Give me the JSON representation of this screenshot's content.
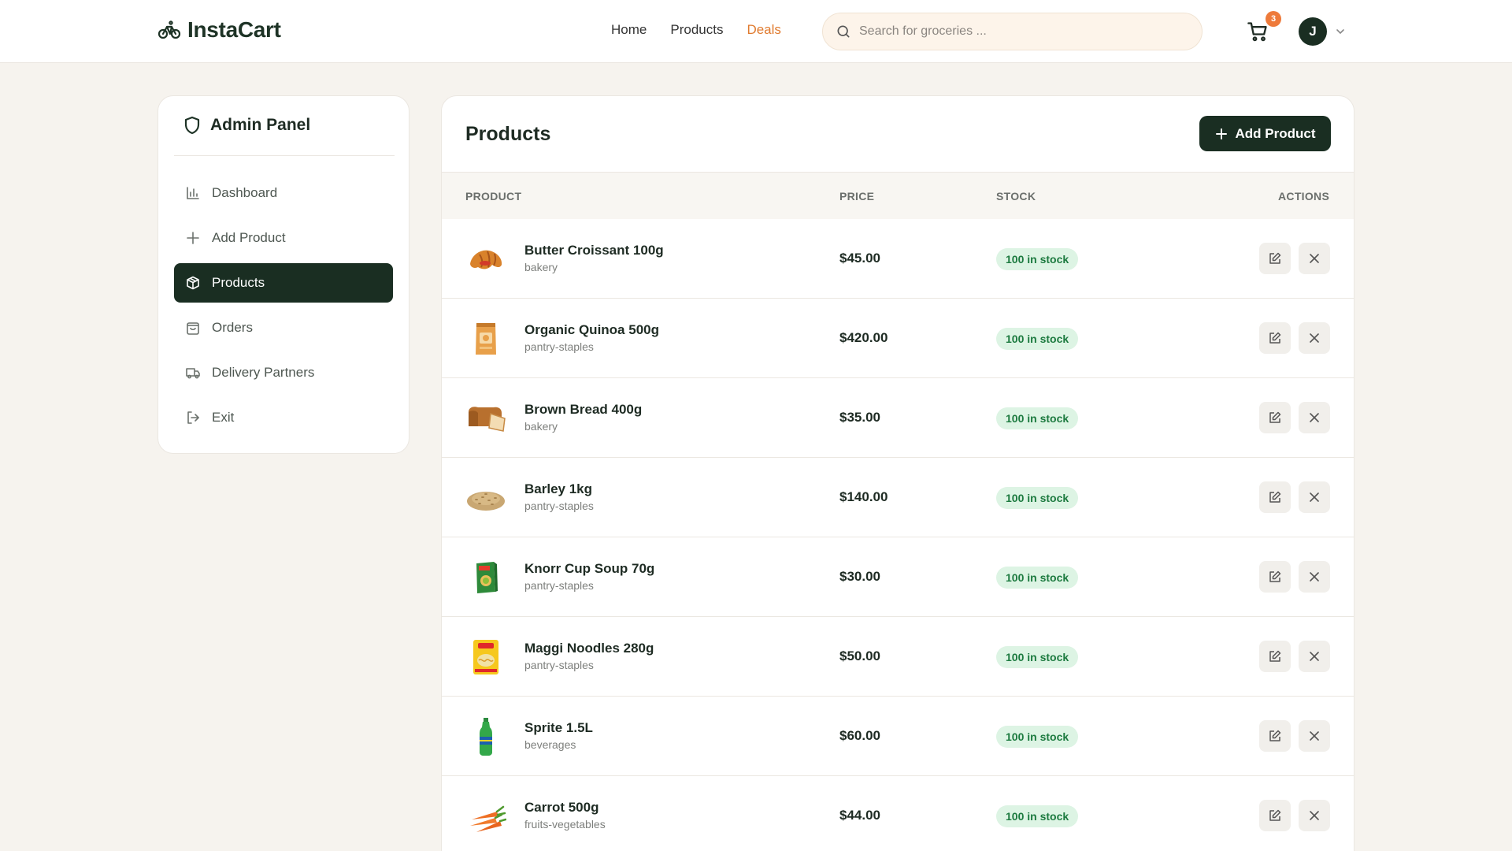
{
  "header": {
    "brand": "InstaCart",
    "nav": [
      {
        "label": "Home",
        "active": false
      },
      {
        "label": "Products",
        "active": false
      },
      {
        "label": "Deals",
        "active": true
      }
    ],
    "search_placeholder": "Search for groceries ...",
    "cart_count": "3",
    "avatar_initial": "J"
  },
  "sidebar": {
    "title": "Admin Panel",
    "items": [
      {
        "label": "Dashboard",
        "icon": "bar-chart-icon",
        "active": false
      },
      {
        "label": "Add Product",
        "icon": "plus-icon",
        "active": false
      },
      {
        "label": "Products",
        "icon": "package-icon",
        "active": true
      },
      {
        "label": "Orders",
        "icon": "shopping-bag-icon",
        "active": false
      },
      {
        "label": "Delivery Partners",
        "icon": "truck-icon",
        "active": false
      },
      {
        "label": "Exit",
        "icon": "logout-icon",
        "active": false
      }
    ]
  },
  "main": {
    "title": "Products",
    "add_button_label": "Add Product",
    "columns": [
      "PRODUCT",
      "PRICE",
      "STOCK",
      "ACTIONS"
    ],
    "rows": [
      {
        "name": "Butter Croissant 100g",
        "category": "bakery",
        "price": "$45.00",
        "stock": "100 in stock",
        "image": "croissant-image"
      },
      {
        "name": "Organic Quinoa 500g",
        "category": "pantry-staples",
        "price": "$420.00",
        "stock": "100 in stock",
        "image": "quinoa-pack-image"
      },
      {
        "name": "Brown Bread 400g",
        "category": "bakery",
        "price": "$35.00",
        "stock": "100 in stock",
        "image": "bread-loaf-image"
      },
      {
        "name": "Barley 1kg",
        "category": "pantry-staples",
        "price": "$140.00",
        "stock": "100 in stock",
        "image": "barley-grain-image"
      },
      {
        "name": "Knorr Cup Soup 70g",
        "category": "pantry-staples",
        "price": "$30.00",
        "stock": "100 in stock",
        "image": "soup-box-image"
      },
      {
        "name": "Maggi Noodles 280g",
        "category": "pantry-staples",
        "price": "$50.00",
        "stock": "100 in stock",
        "image": "noodles-pack-image"
      },
      {
        "name": "Sprite 1.5L",
        "category": "beverages",
        "price": "$60.00",
        "stock": "100 in stock",
        "image": "soda-bottle-image"
      },
      {
        "name": "Carrot 500g",
        "category": "fruits-vegetables",
        "price": "$44.00",
        "stock": "100 in stock",
        "image": "carrots-image"
      }
    ]
  },
  "colors": {
    "primary_dark": "#1a2e22",
    "accent_orange": "#e07a2e",
    "stock_bg": "#ddf4e4",
    "stock_text": "#1c7a3f",
    "page_bg": "#f6f3ee"
  }
}
